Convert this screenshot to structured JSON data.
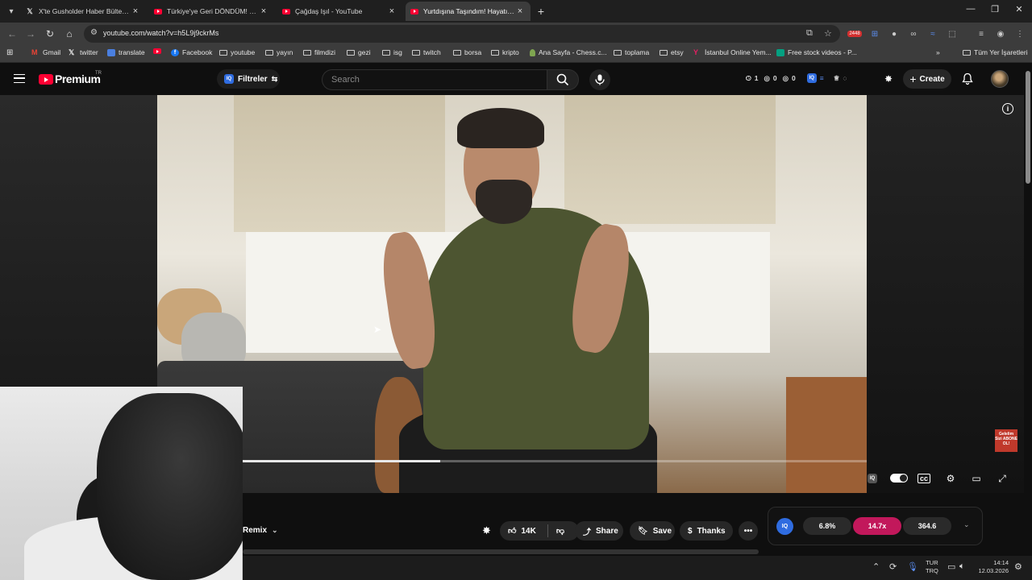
{
  "browser": {
    "tabs": [
      {
        "label": "X'te Gusholder Haber Bülteni: \"",
        "icon": "x-icon"
      },
      {
        "label": "Türkiye'ye Geri DÖNDÜM! @3(",
        "icon": "youtube-icon"
      },
      {
        "label": "Çağdaş Işıl - YouTube",
        "icon": "youtube-icon"
      },
      {
        "label": "Yurtdışına Taşındım! Hayatım D",
        "icon": "youtube-icon"
      }
    ],
    "url": "youtube.com/watch?v=h5L9j9ckrMs",
    "ext_badge": "2448",
    "bookmarks": [
      {
        "label": "Gmail",
        "icon": "gmail-icon"
      },
      {
        "label": "twitter",
        "icon": "x-icon"
      },
      {
        "label": "translate",
        "icon": "translate-icon"
      },
      {
        "label": "",
        "icon": "youtube-icon"
      },
      {
        "label": "Facebook",
        "icon": "facebook-icon"
      },
      {
        "label": "youtube",
        "icon": "folder-icon"
      },
      {
        "label": "yayın",
        "icon": "folder-icon"
      },
      {
        "label": "filmdizi",
        "icon": "folder-icon"
      },
      {
        "label": "gezi",
        "icon": "folder-icon"
      },
      {
        "label": "isg",
        "icon": "folder-icon"
      },
      {
        "label": "twitch",
        "icon": "folder-icon"
      },
      {
        "label": "borsa",
        "icon": "folder-icon"
      },
      {
        "label": "kripto",
        "icon": "folder-icon"
      },
      {
        "label": "Ana Sayfa - Chess.c...",
        "icon": "chess-icon"
      },
      {
        "label": "toplama",
        "icon": "folder-icon"
      },
      {
        "label": "etsy",
        "icon": "folder-icon"
      },
      {
        "label": "İstanbul Online Yem...",
        "icon": "yemek-icon"
      },
      {
        "label": "Free stock videos - P...",
        "icon": "pexels-icon"
      }
    ],
    "all_bookmarks": "Tüm Yer İşaretleri"
  },
  "youtube": {
    "logo_text": "Premium",
    "country": "TR",
    "filter_label": "Filtreler",
    "search_placeholder": "Search",
    "stats": {
      "clock": "1",
      "views": "0",
      "eye2": "0"
    },
    "create_label": "Create",
    "remix_label": "Remix",
    "like_count": "14K",
    "share_label": "Share",
    "save_label": "Save",
    "thanks_label": "Thanks",
    "sub_badge": "Gelelim Sizi ABONE OL!",
    "iq": {
      "badge": "IQ",
      "m1": "6.8%",
      "m2": "14.7x",
      "m3": "364.6"
    },
    "progress": 0.318
  },
  "taskbar": {
    "lang_top": "TUR",
    "lang_bottom": "TRQ",
    "time": "14:14",
    "date": "12.03.2026"
  },
  "colors": {
    "accent": "#ff0033",
    "iq_blue": "#2f6ce0",
    "metric_pink": "#c2185b"
  }
}
